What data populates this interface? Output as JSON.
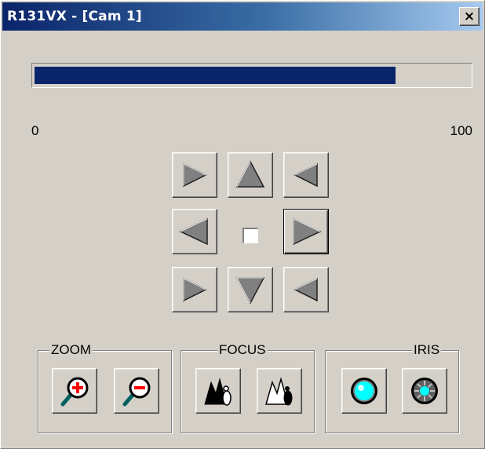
{
  "window": {
    "title": "R131VX - [Cam 1]",
    "close_glyph": "×",
    "titlebar_gradient": [
      "#0a246a",
      "#a6caf0"
    ],
    "face_color": "#d4d0c8"
  },
  "progress": {
    "value": 83,
    "min_label": "0",
    "max_label": "100",
    "fill_color": "#0a246a"
  },
  "ptz": {
    "buttons": [
      {
        "name": "pan-tilt-up-left",
        "icon": "arrow-up-left-icon"
      },
      {
        "name": "tilt-up",
        "icon": "arrow-up-icon"
      },
      {
        "name": "pan-tilt-up-right",
        "icon": "arrow-up-right-icon"
      },
      {
        "name": "pan-left",
        "icon": "arrow-left-icon"
      },
      {
        "name": "pan-right",
        "icon": "arrow-right-icon"
      },
      {
        "name": "pan-tilt-down-left",
        "icon": "arrow-down-left-icon"
      },
      {
        "name": "tilt-down",
        "icon": "arrow-down-icon"
      },
      {
        "name": "pan-tilt-down-right",
        "icon": "arrow-down-right-icon"
      }
    ],
    "center_checkbox_checked": false
  },
  "groups": {
    "zoom": {
      "label": "ZOOM",
      "buttons": [
        "zoom-in-icon",
        "zoom-out-icon"
      ]
    },
    "focus": {
      "label": "FOCUS",
      "buttons": [
        "focus-near-icon",
        "focus-far-icon"
      ]
    },
    "iris": {
      "label": "IRIS",
      "buttons": [
        "iris-open-icon",
        "iris-close-icon"
      ]
    }
  },
  "colors": {
    "zoom_plus": "#ff0000",
    "zoom_minus": "#ff0000",
    "iris_cyan": "#00ffff"
  }
}
